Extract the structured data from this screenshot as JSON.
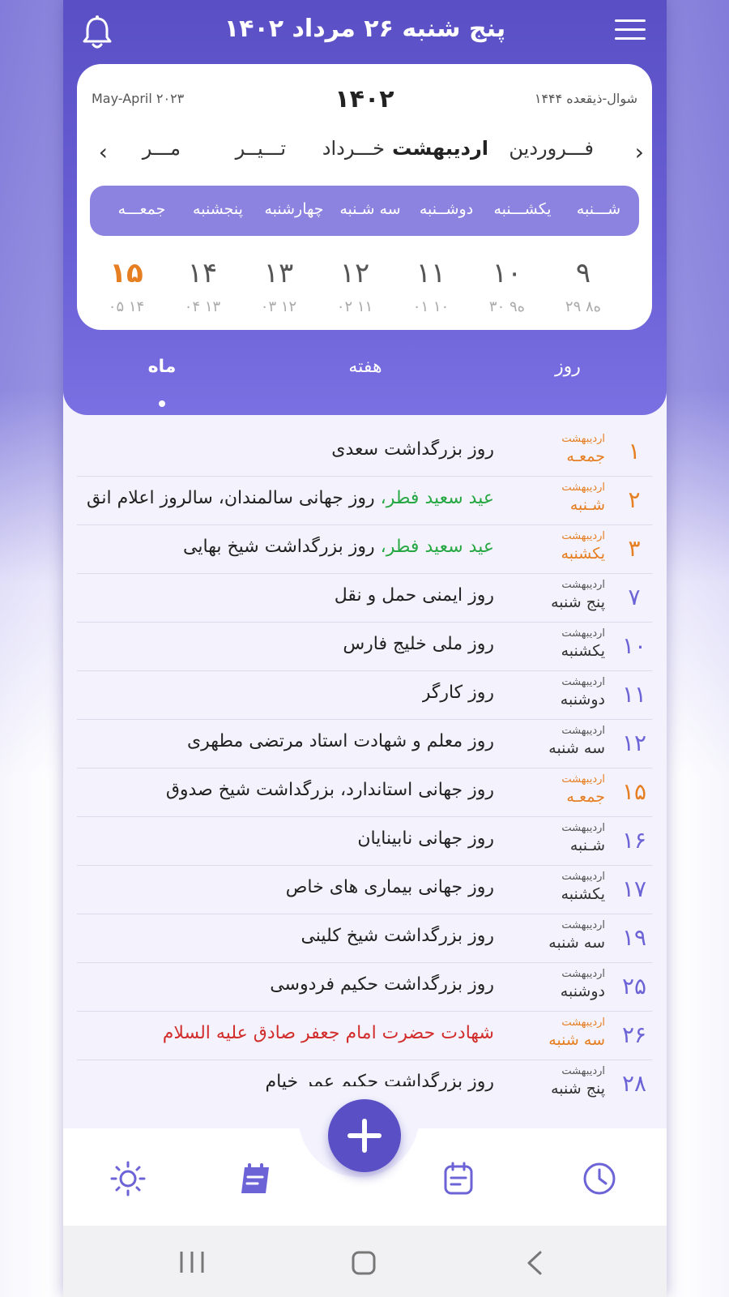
{
  "header": {
    "title": "پنج شنبه ۲۶ مرداد ۱۴۰۲"
  },
  "calendar": {
    "gregorian": "May-April ۲۰۲۳",
    "year": "۱۴۰۲",
    "hijri": "شوال-ذیقعده ۱۴۴۴",
    "months": [
      "فـــروردین",
      "اردیبهشت",
      "خـــرداد",
      "تـــیــر",
      "مـــر"
    ],
    "active_month": "اردیبهشت",
    "weekdays": [
      "شـــنبه",
      "یکشـــنبه",
      "دوشــنبه",
      "سه شـنبه",
      "چهارشنبه",
      "پنجشنبه",
      "جمعـــه"
    ],
    "days": [
      {
        "num": "۹",
        "sub": "۲۹ ۸ه"
      },
      {
        "num": "۱۰",
        "sub": "۳۰ ۹ه"
      },
      {
        "num": "۱۱",
        "sub": "۰۱ ۱۰"
      },
      {
        "num": "۱۲",
        "sub": "۰۲ ۱۱"
      },
      {
        "num": "۱۳",
        "sub": "۰۳ ۱۲"
      },
      {
        "num": "۱۴",
        "sub": "۰۴ ۱۳"
      },
      {
        "num": "۱۵",
        "sub": "۰۵ ۱۴",
        "today": true
      }
    ]
  },
  "tabs": [
    "روز",
    "هفته",
    "ماه"
  ],
  "active_tab": "ماه",
  "events": [
    {
      "num": "۱",
      "month": "اردیبهشت",
      "day": "جمعـه",
      "holiday": true,
      "text": "روز بزرگداشت سعدی"
    },
    {
      "num": "۲",
      "month": "اردیبهشت",
      "day": "شـنبه",
      "holiday": true,
      "green": "عید سعید فطر، ",
      "text": "روز جهانی سالمندان، سالروز اعلام انق"
    },
    {
      "num": "۳",
      "month": "اردیبهشت",
      "day": "یکشنبه",
      "holiday": true,
      "green": "عید سعید فطر، ",
      "text": "روز بزرگداشت شیخ بهایی"
    },
    {
      "num": "۷",
      "month": "اردیبهشت",
      "day": "پنج شنبه",
      "text": "روز ایمنی حمل و نقل"
    },
    {
      "num": "۱۰",
      "month": "اردیبهشت",
      "day": "یکشنبه",
      "text": "روز ملی خلیج فارس"
    },
    {
      "num": "۱۱",
      "month": "اردیبهشت",
      "day": "دوشنبه",
      "text": "روز کارگر"
    },
    {
      "num": "۱۲",
      "month": "اردیبهشت",
      "day": "سه شنبه",
      "text": "روز معلم و شهادت استاد مرتضی مطهری"
    },
    {
      "num": "۱۵",
      "month": "اردیبهشت",
      "day": "جمعـه",
      "holiday": true,
      "text": "روز جهانی استاندارد، بزرگداشت شیخ صدوق"
    },
    {
      "num": "۱۶",
      "month": "اردیبهشت",
      "day": "شـنبه",
      "text": "روز جهانی نابینایان"
    },
    {
      "num": "۱۷",
      "month": "اردیبهشت",
      "day": "یکشنبه",
      "text": "روز جهانی بیماری های خاص"
    },
    {
      "num": "۱۹",
      "month": "اردیبهشت",
      "day": "سه شنبه",
      "text": "روز بزرگداشت شیخ کلینی"
    },
    {
      "num": "۲۵",
      "month": "اردیبهشت",
      "day": "دوشنبه",
      "text": "روز بزرگداشت حکیم  فردوسی"
    },
    {
      "num": "۲۶",
      "month": "اردیبهشت",
      "day": "سه شنبه",
      "holiday": true,
      "red": true,
      "text": "شهادت حضرت امام جعفر صادق علیه السلام"
    },
    {
      "num": "۲۸",
      "month": "اردیبهشت",
      "day": "پنج شنبه",
      "text": "روز بزرگداشت حکیم عمر خیام"
    }
  ],
  "colors": {
    "primary": "#5a4fc4",
    "holiday": "#e67e22",
    "green": "#27a844",
    "red": "#d22d2d"
  },
  "nav_icons": [
    "weather-icon",
    "notes-icon",
    "calendar-icon",
    "clock-icon"
  ]
}
